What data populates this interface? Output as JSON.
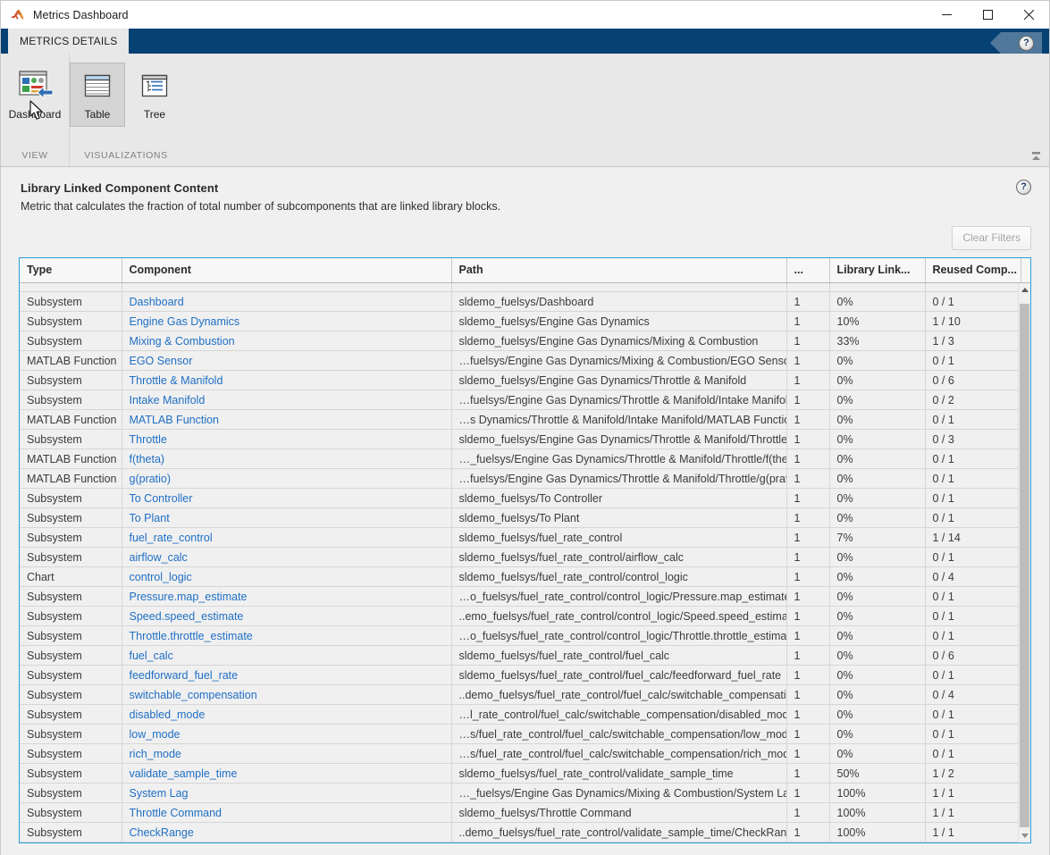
{
  "window": {
    "title": "Metrics Dashboard",
    "minimize_label": "Minimize",
    "maximize_label": "Maximize",
    "close_label": "Close"
  },
  "ribbon": {
    "tab": "METRICS DETAILS",
    "help_glyph": "?",
    "groups": [
      {
        "label": "VIEW",
        "buttons": [
          {
            "label": "Dashboard",
            "icon": "dashboard-icon",
            "selected": false
          }
        ]
      },
      {
        "label": "VISUALIZATIONS",
        "buttons": [
          {
            "label": "Table",
            "icon": "table-icon",
            "selected": true
          },
          {
            "label": "Tree",
            "icon": "tree-icon",
            "selected": false
          }
        ]
      }
    ],
    "collapse_label": "Minimize Ribbon"
  },
  "panel": {
    "title": "Library Linked Component Content",
    "description": "Metric that calculates the fraction of total number of subcomponents that are linked library blocks.",
    "help_glyph": "?",
    "clear_filters": "Clear Filters"
  },
  "table": {
    "columns": [
      {
        "key": "type",
        "label": "Type"
      },
      {
        "key": "component",
        "label": "Component"
      },
      {
        "key": "path",
        "label": "Path"
      },
      {
        "key": "count",
        "label": "..."
      },
      {
        "key": "library_link",
        "label": "Library Link..."
      },
      {
        "key": "reused",
        "label": "Reused Comp..."
      }
    ],
    "rows": [
      {
        "type": "Subsystem",
        "component": "Dashboard",
        "path": "sldemo_fuelsys/Dashboard",
        "count": "1",
        "library_link": "0%",
        "reused": "0 / 1"
      },
      {
        "type": "Subsystem",
        "component": "Engine Gas Dynamics",
        "path": "sldemo_fuelsys/Engine Gas Dynamics",
        "count": "1",
        "library_link": "10%",
        "reused": "1 / 10"
      },
      {
        "type": "Subsystem",
        "component": "Mixing & Combustion",
        "path": "sldemo_fuelsys/Engine Gas Dynamics/Mixing & Combustion",
        "count": "1",
        "library_link": "33%",
        "reused": "1 / 3"
      },
      {
        "type": "MATLAB Function",
        "component": "EGO Sensor",
        "path": "…fuelsys/Engine Gas Dynamics/Mixing & Combustion/EGO Sensor",
        "count": "1",
        "library_link": "0%",
        "reused": "0 / 1"
      },
      {
        "type": "Subsystem",
        "component": "Throttle & Manifold",
        "path": "sldemo_fuelsys/Engine Gas Dynamics/Throttle & Manifold",
        "count": "1",
        "library_link": "0%",
        "reused": "0 / 6"
      },
      {
        "type": "Subsystem",
        "component": "Intake Manifold",
        "path": "…fuelsys/Engine Gas Dynamics/Throttle & Manifold/Intake Manifold",
        "count": "1",
        "library_link": "0%",
        "reused": "0 / 2"
      },
      {
        "type": "MATLAB Function",
        "component": "MATLAB Function",
        "path": "…s Dynamics/Throttle & Manifold/Intake Manifold/MATLAB Function",
        "count": "1",
        "library_link": "0%",
        "reused": "0 / 1"
      },
      {
        "type": "Subsystem",
        "component": "Throttle",
        "path": "sldemo_fuelsys/Engine Gas Dynamics/Throttle & Manifold/Throttle",
        "count": "1",
        "library_link": "0%",
        "reused": "0 / 3"
      },
      {
        "type": "MATLAB Function",
        "component": "f(theta)",
        "path": "…_fuelsys/Engine Gas Dynamics/Throttle & Manifold/Throttle/f(theta",
        "count": "1",
        "library_link": "0%",
        "reused": "0 / 1"
      },
      {
        "type": "MATLAB Function",
        "component": "g(pratio)",
        "path": "…fuelsys/Engine Gas Dynamics/Throttle & Manifold/Throttle/g(pratio",
        "count": "1",
        "library_link": "0%",
        "reused": "0 / 1"
      },
      {
        "type": "Subsystem",
        "component": "To Controller",
        "path": "sldemo_fuelsys/To Controller",
        "count": "1",
        "library_link": "0%",
        "reused": "0 / 1"
      },
      {
        "type": "Subsystem",
        "component": "To Plant",
        "path": "sldemo_fuelsys/To Plant",
        "count": "1",
        "library_link": "0%",
        "reused": "0 / 1"
      },
      {
        "type": "Subsystem",
        "component": "fuel_rate_control",
        "path": "sldemo_fuelsys/fuel_rate_control",
        "count": "1",
        "library_link": "7%",
        "reused": "1 / 14"
      },
      {
        "type": "Subsystem",
        "component": "airflow_calc",
        "path": "sldemo_fuelsys/fuel_rate_control/airflow_calc",
        "count": "1",
        "library_link": "0%",
        "reused": "0 / 1"
      },
      {
        "type": "Chart",
        "component": "control_logic",
        "path": "sldemo_fuelsys/fuel_rate_control/control_logic",
        "count": "1",
        "library_link": "0%",
        "reused": "0 / 4"
      },
      {
        "type": "Subsystem",
        "component": "Pressure.map_estimate",
        "path": "…o_fuelsys/fuel_rate_control/control_logic/Pressure.map_estimate",
        "count": "1",
        "library_link": "0%",
        "reused": "0 / 1"
      },
      {
        "type": "Subsystem",
        "component": "Speed.speed_estimate",
        "path": "..emo_fuelsys/fuel_rate_control/control_logic/Speed.speed_estimate",
        "count": "1",
        "library_link": "0%",
        "reused": "0 / 1"
      },
      {
        "type": "Subsystem",
        "component": "Throttle.throttle_estimate",
        "path": "…o_fuelsys/fuel_rate_control/control_logic/Throttle.throttle_estimate",
        "count": "1",
        "library_link": "0%",
        "reused": "0 / 1"
      },
      {
        "type": "Subsystem",
        "component": "fuel_calc",
        "path": "sldemo_fuelsys/fuel_rate_control/fuel_calc",
        "count": "1",
        "library_link": "0%",
        "reused": "0 / 6"
      },
      {
        "type": "Subsystem",
        "component": "feedforward_fuel_rate",
        "path": "sldemo_fuelsys/fuel_rate_control/fuel_calc/feedforward_fuel_rate",
        "count": "1",
        "library_link": "0%",
        "reused": "0 / 1"
      },
      {
        "type": "Subsystem",
        "component": "switchable_compensation",
        "path": "..demo_fuelsys/fuel_rate_control/fuel_calc/switchable_compensation",
        "count": "1",
        "library_link": "0%",
        "reused": "0 / 4"
      },
      {
        "type": "Subsystem",
        "component": "disabled_mode",
        "path": "…l_rate_control/fuel_calc/switchable_compensation/disabled_mode",
        "count": "1",
        "library_link": "0%",
        "reused": "0 / 1"
      },
      {
        "type": "Subsystem",
        "component": "low_mode",
        "path": "…s/fuel_rate_control/fuel_calc/switchable_compensation/low_mode",
        "count": "1",
        "library_link": "0%",
        "reused": "0 / 1"
      },
      {
        "type": "Subsystem",
        "component": "rich_mode",
        "path": "…s/fuel_rate_control/fuel_calc/switchable_compensation/rich_mode",
        "count": "1",
        "library_link": "0%",
        "reused": "0 / 1"
      },
      {
        "type": "Subsystem",
        "component": "validate_sample_time",
        "path": "sldemo_fuelsys/fuel_rate_control/validate_sample_time",
        "count": "1",
        "library_link": "50%",
        "reused": "1 / 2"
      },
      {
        "type": "Subsystem",
        "component": "System Lag",
        "path": "…_fuelsys/Engine Gas Dynamics/Mixing & Combustion/System Lag",
        "count": "1",
        "library_link": "100%",
        "reused": "1 / 1"
      },
      {
        "type": "Subsystem",
        "component": "Throttle Command",
        "path": "sldemo_fuelsys/Throttle Command",
        "count": "1",
        "library_link": "100%",
        "reused": "1 / 1"
      },
      {
        "type": "Subsystem",
        "component": "CheckRange",
        "path": "..demo_fuelsys/fuel_rate_control/validate_sample_time/CheckRange",
        "count": "1",
        "library_link": "100%",
        "reused": "1 / 1"
      }
    ],
    "scroll_up_label": "Scroll up",
    "scroll_down_label": "Scroll down"
  },
  "colors": {
    "ribbon_tabstrip": "#064173",
    "link": "#1f6fc4",
    "grid_border": "#2d9cdb",
    "panel_bg": "#f0f0f0"
  }
}
